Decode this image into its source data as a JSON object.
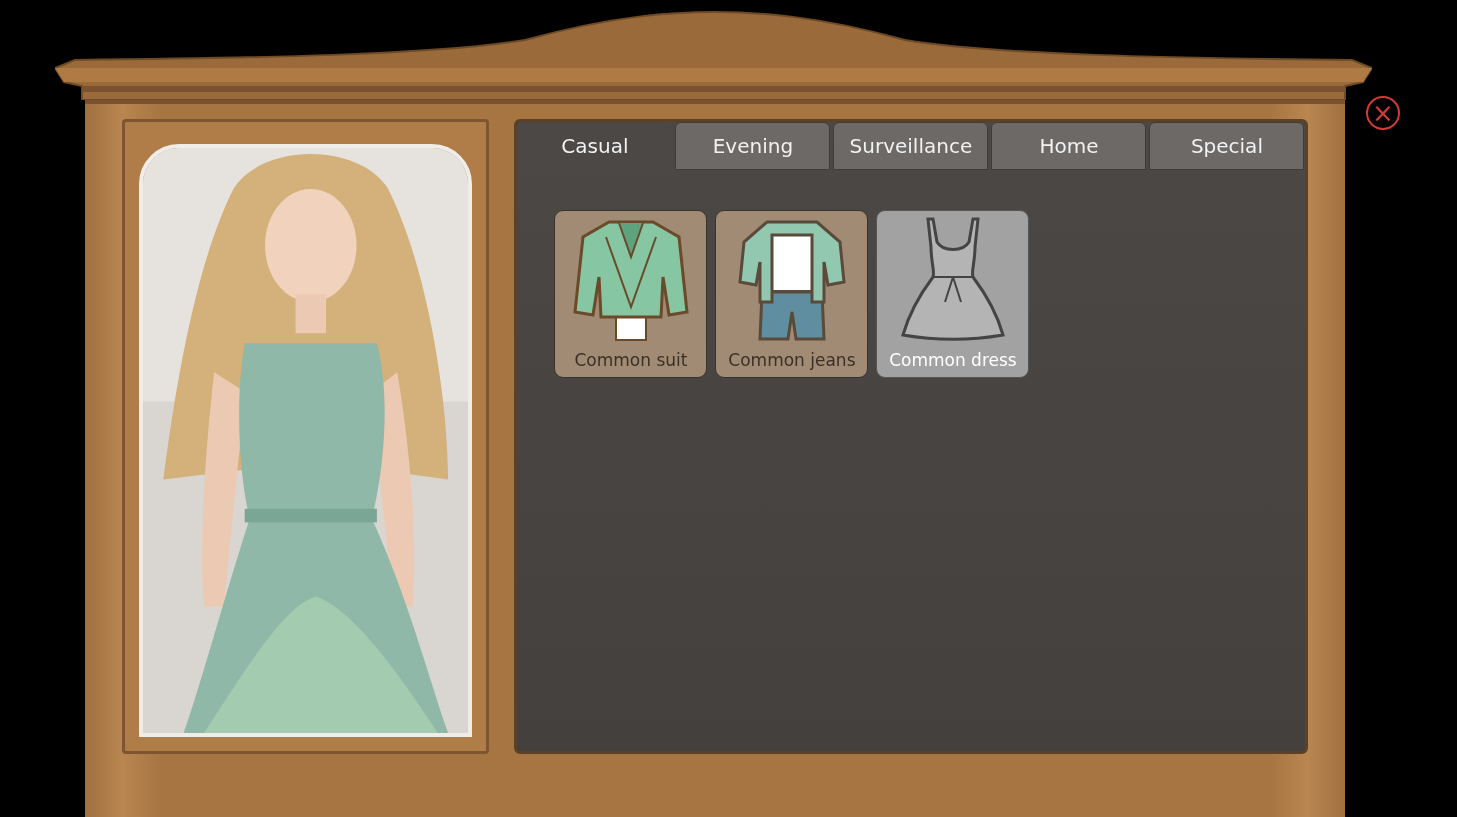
{
  "tabs": [
    {
      "label": "Casual",
      "selected": true
    },
    {
      "label": "Evening",
      "selected": false
    },
    {
      "label": "Surveillance",
      "selected": false
    },
    {
      "label": "Home",
      "selected": false
    },
    {
      "label": "Special",
      "selected": false
    }
  ],
  "items": [
    {
      "label": "Common suit",
      "kind": "jacket",
      "selected": false
    },
    {
      "label": "Common jeans",
      "kind": "jeans",
      "selected": false
    },
    {
      "label": "Common dress",
      "kind": "dress",
      "selected": true
    }
  ],
  "close_button": {
    "label": "×"
  }
}
